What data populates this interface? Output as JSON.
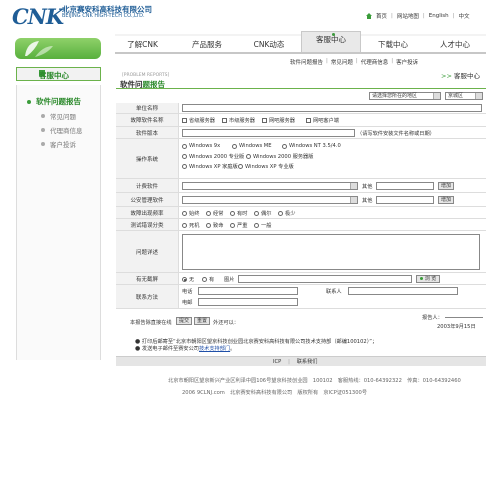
{
  "logo": {
    "mark": "CNK",
    "name_cn": "北京赛安科高科技有限公司",
    "name_en": "BEIJING CNK HIGH-TECH CO.,LTD."
  },
  "top_links": {
    "home": "首页",
    "sitemap": "网站地图",
    "english": "English",
    "chinese": "中文"
  },
  "nav": [
    "了解CNK",
    "产品服务",
    "CNK动态",
    "客服中心",
    "下载中心",
    "人才中心"
  ],
  "sidebar": {
    "title": "客服中心",
    "items": [
      "软件问题报告",
      "常见问题",
      "代理商信息",
      "客户投诉"
    ]
  },
  "subnav": [
    "软件问题报告",
    "常见问题",
    "代理商信息",
    "客户投诉"
  ],
  "breadcrumb": "客服中心",
  "section": {
    "en": "[PROBLEM REPORTS]",
    "title_prefix": "软件问",
    "title_suffix": "题报告"
  },
  "region": {
    "select_placeholder": "请选择您所在的地区",
    "province": "京城区"
  },
  "form": {
    "unit_label": "单位名称",
    "date_label": "故障软件名称",
    "software_opts": [
      "省级服务器",
      "市级服务器",
      "网吧服务器",
      "网吧客户端"
    ],
    "version_label": "软件版本",
    "version_hint": "（请写软件安装文件名称或日期）",
    "os_label": "操作系统",
    "os_opts": [
      "Windows 9x",
      "Windows ME",
      "Windows NT 3.5/4.0",
      "Windows 2000 专业版",
      "Windows 2000 服务器版",
      "Windows XP 家庭版",
      "Windows XP 专业版"
    ],
    "billing_label": "计费软件",
    "other_label": "其他",
    "add_label": "增加",
    "security_label": "公安管理软件",
    "freq_label": "故障出现频率",
    "freq_opts": [
      "始终",
      "经常",
      "有时",
      "偶尔",
      "极少"
    ],
    "severity_label": "测试错误分类",
    "severity_opts": [
      "死机",
      "致命",
      "严重",
      "一般"
    ],
    "detail_label": "问题详述",
    "screenshot_label": "有无截屏",
    "screenshot_opts": [
      "无",
      "有"
    ],
    "image_label": "图片",
    "browse_label": "浏 览",
    "contact_label": "联系方法",
    "phone_label": "电话",
    "person_label": "联系人",
    "email_label": "电邮",
    "submit_text_pre": "本报告除直接在线",
    "submit_label": "提交",
    "reset_label": "重置",
    "submit_text_post": "外还可以："
  },
  "reporter_label": "报告人：",
  "report_date": "2003年9月15日",
  "notes": {
    "print": "打印后邮寄至“北京市朝阳区望京科技创业园北京赛安科高科技有限公司技术支持部（邮编100102）”；",
    "mail_pre": "发送电子邮件至赛安公司",
    "mail_link": "技术支持部门",
    "mail_post": "。"
  },
  "footer": {
    "links": [
      "ICP",
      "联系我们"
    ],
    "address": "北京市朝阳区望京新兴产业区利泽中园106号望京科技创业园　100102　客服热线：010-64392322　传真：010-64392460",
    "copyright": "2006 9CLNJ.com　北京赛安科高科技有限公司　版权所有　京ICP证051300号"
  },
  "colors": {
    "brand": "#1f5d96",
    "accent_green": "#3a9c3a"
  }
}
